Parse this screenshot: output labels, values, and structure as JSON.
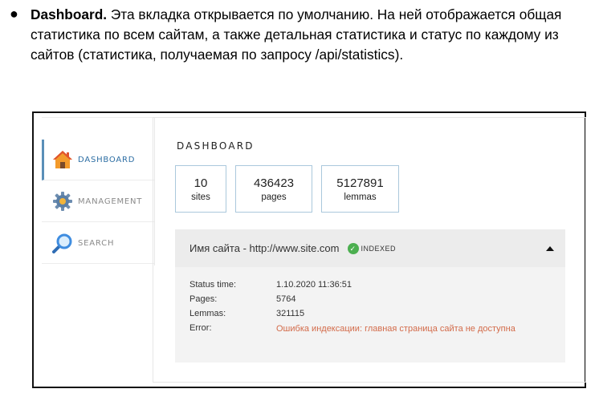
{
  "intro": {
    "bullet": "●",
    "heading": "Dashboard.",
    "text": " Эта вкладка открывается по умолчанию. На ней отображается общая статистика по всем сайтам, а также детальная статистика и статус по каждому из сайтов (статистика, получаемая по запросу /api/statistics)."
  },
  "sidebar": {
    "items": [
      {
        "label": "DASHBOARD",
        "icon": "home-icon",
        "active": true
      },
      {
        "label": "MANAGEMENT",
        "icon": "gear-icon",
        "active": false
      },
      {
        "label": "SEARCH",
        "icon": "search-icon",
        "active": false
      }
    ]
  },
  "main": {
    "title": "DASHBOARD",
    "stats": [
      {
        "value": "10",
        "label": "sites"
      },
      {
        "value": "436423",
        "label": "pages"
      },
      {
        "value": "5127891",
        "label": "lemmas"
      }
    ],
    "site": {
      "name": "Имя сайта - http://www.site.com",
      "status": "INDEXED",
      "status_color": "#4caf50",
      "rows": [
        {
          "label": "Status time:",
          "value": "1.10.2020 11:36:51"
        },
        {
          "label": "Pages:",
          "value": "5764"
        },
        {
          "label": "Lemmas:",
          "value": "321115"
        },
        {
          "label": "Error:",
          "value": "Ошибка индексации: главная страница сайта не доступна"
        }
      ]
    }
  },
  "colors": {
    "accent": "#2d6ea3",
    "error": "#d36b4a",
    "stat_border": "#aac8dc"
  }
}
